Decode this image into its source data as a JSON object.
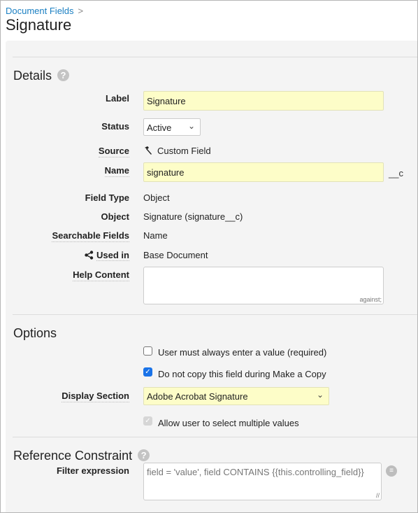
{
  "breadcrumb": {
    "parent": "Document Fields",
    "separator": ">"
  },
  "page_title": "Signature",
  "details": {
    "title": "Details",
    "help_icon": "question-circle-icon",
    "label": {
      "label": "Label",
      "value": "Signature"
    },
    "status": {
      "label": "Status",
      "value": "Active"
    },
    "source": {
      "label": "Source",
      "icon": "hammer-icon",
      "value": "Custom Field"
    },
    "name": {
      "label": "Name",
      "value": "signature",
      "suffix": "__c"
    },
    "field_type": {
      "label": "Field Type",
      "value": "Object"
    },
    "object": {
      "label": "Object",
      "value": "Signature (signature__c)"
    },
    "searchable_fields": {
      "label": "Searchable Fields",
      "value": "Name"
    },
    "used_in": {
      "label": "Used in",
      "icon": "share-icon",
      "value": "Base Document"
    },
    "help_content": {
      "label": "Help Content",
      "value": ""
    }
  },
  "options": {
    "title": "Options",
    "required": {
      "label": "User must always enter a value (required)",
      "checked": false
    },
    "no_copy": {
      "label": "Do not copy this field during Make a Copy",
      "checked": true
    },
    "display_section": {
      "label": "Display Section",
      "value": "Adobe Acrobat Signature"
    },
    "multi_select": {
      "label": "Allow user to select multiple values",
      "checked": true,
      "disabled": true
    }
  },
  "reference_constraint": {
    "title": "Reference Constraint",
    "help_icon": "question-circle-icon",
    "filter": {
      "label": "Filter expression",
      "placeholder": "field = 'value', field CONTAINS {{this.controlling_field}}",
      "icon": "lookup-icon"
    }
  }
}
